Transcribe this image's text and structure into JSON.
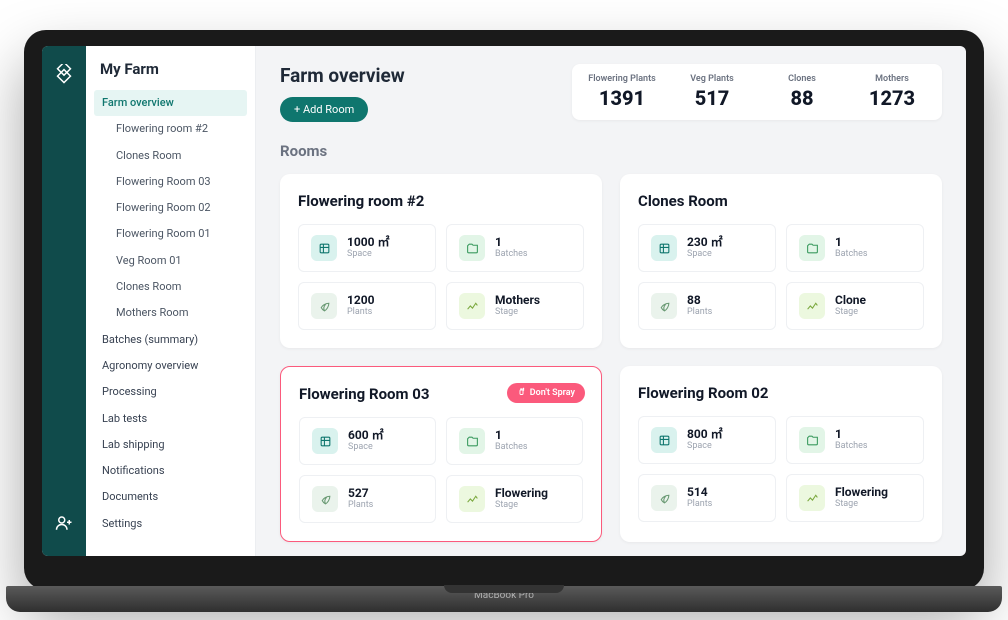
{
  "sidebar": {
    "title": "My Farm",
    "items": [
      {
        "label": "Farm overview",
        "active": true
      },
      {
        "label": "Flowering room #2",
        "child": true
      },
      {
        "label": "Clones Room",
        "child": true
      },
      {
        "label": "Flowering Room 03",
        "child": true
      },
      {
        "label": "Flowering Room 02",
        "child": true
      },
      {
        "label": "Flowering Room 01",
        "child": true
      },
      {
        "label": "Veg Room 01",
        "child": true
      },
      {
        "label": "Clones Room",
        "child": true
      },
      {
        "label": "Mothers Room",
        "child": true
      },
      {
        "label": "Batches (summary)"
      },
      {
        "label": "Agronomy overview"
      },
      {
        "label": "Processing"
      },
      {
        "label": "Lab tests"
      },
      {
        "label": "Lab shipping"
      },
      {
        "label": "Notifications"
      },
      {
        "label": "Documents"
      },
      {
        "label": "Settings"
      }
    ]
  },
  "header": {
    "title": "Farm overview",
    "add_button": "+ Add Room",
    "stats": [
      {
        "label": "Flowering Plants",
        "value": "1391"
      },
      {
        "label": "Veg Plants",
        "value": "517"
      },
      {
        "label": "Clones",
        "value": "88"
      },
      {
        "label": "Mothers",
        "value": "1273"
      }
    ]
  },
  "rooms_heading": "Rooms",
  "rooms": [
    {
      "name": "Flowering room #2",
      "alert": null,
      "metrics": {
        "space": {
          "value": "1000 ㎡",
          "label": "Space"
        },
        "batches": {
          "value": "1",
          "label": "Batches"
        },
        "plants": {
          "value": "1200",
          "label": "Plants"
        },
        "stage": {
          "value": "Mothers",
          "label": "Stage"
        }
      }
    },
    {
      "name": "Clones Room",
      "alert": null,
      "metrics": {
        "space": {
          "value": "230 ㎡",
          "label": "Space"
        },
        "batches": {
          "value": "1",
          "label": "Batches"
        },
        "plants": {
          "value": "88",
          "label": "Plants"
        },
        "stage": {
          "value": "Clone",
          "label": "Stage"
        }
      }
    },
    {
      "name": "Flowering Room 03",
      "alert": "Don't Spray",
      "metrics": {
        "space": {
          "value": "600 ㎡",
          "label": "Space"
        },
        "batches": {
          "value": "1",
          "label": "Batches"
        },
        "plants": {
          "value": "527",
          "label": "Plants"
        },
        "stage": {
          "value": "Flowering",
          "label": "Stage"
        }
      }
    },
    {
      "name": "Flowering Room 02",
      "alert": null,
      "metrics": {
        "space": {
          "value": "800 ㎡",
          "label": "Space"
        },
        "batches": {
          "value": "1",
          "label": "Batches"
        },
        "plants": {
          "value": "514",
          "label": "Plants"
        },
        "stage": {
          "value": "Flowering",
          "label": "Stage"
        }
      }
    }
  ],
  "laptop_label": "MacBook Pro"
}
